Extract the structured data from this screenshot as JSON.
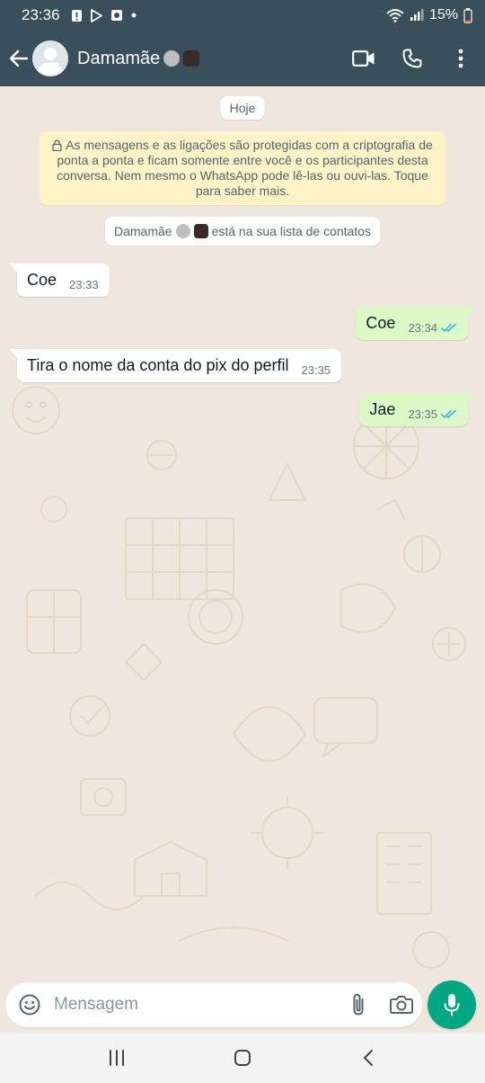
{
  "status_bar": {
    "time": "23:36",
    "battery_percent": "15%",
    "icons": [
      "alert-icon",
      "play-store-icon",
      "app-icon",
      "dot-icon",
      "wifi-icon",
      "signal-icon",
      "battery-icon"
    ]
  },
  "header": {
    "contact_name": "Damamãe",
    "emojis": [
      "boxer-emoji",
      "ninja-emoji"
    ],
    "actions": [
      "video-call-icon",
      "voice-call-icon",
      "more-options-icon"
    ]
  },
  "chat": {
    "date_chip": "Hoje",
    "encryption_notice": "As mensagens e as ligações são protegidas com a criptografia de ponta a ponta e ficam somente entre você e os participantes desta conversa. Nem mesmo o WhatsApp pode lê-las ou ouvi-las. Toque para saber mais.",
    "contact_notice": {
      "name": "Damamãe",
      "suffix": "está na sua lista de contatos"
    },
    "messages": [
      {
        "direction": "incoming",
        "text": "Coe",
        "time": "23:33"
      },
      {
        "direction": "outgoing",
        "text": "Coe",
        "time": "23:34",
        "status": "read"
      },
      {
        "direction": "incoming",
        "text": "Tira o nome da conta do pix do perfil",
        "time": "23:35"
      },
      {
        "direction": "outgoing",
        "text": "Jae",
        "time": "23:35",
        "status": "read"
      }
    ]
  },
  "composer": {
    "placeholder": "Mensagem",
    "value": ""
  },
  "colors": {
    "header": "#3a4f5c",
    "outgoing_bubble": "#dcf8c6",
    "incoming_bubble": "#ffffff",
    "read_ticks": "#34b7f1",
    "mic_button": "#00a884",
    "notice_bg": "#fdf3c6"
  }
}
